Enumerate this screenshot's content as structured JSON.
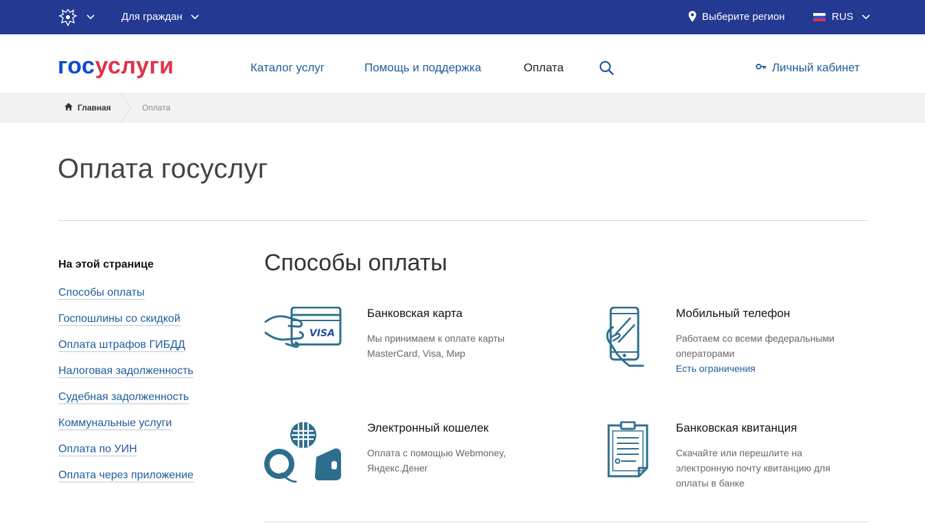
{
  "topbar": {
    "audience_label": "Для граждан",
    "region_label": "Выберите регион",
    "language_label": "RUS"
  },
  "header": {
    "logo_part1": "гос",
    "logo_part2": "услуги",
    "nav": {
      "catalog": "Каталог услуг",
      "help": "Помощь и поддержка",
      "payment": "Оплата"
    },
    "cabinet_label": "Личный кабинет"
  },
  "breadcrumb": {
    "home": "Главная",
    "current": "Оплата"
  },
  "page": {
    "title": "Оплата госуслуг"
  },
  "sidebar": {
    "heading": "На этой странице",
    "links": [
      "Способы оплаты",
      "Госпошлины со скидкой",
      "Оплата штрафов ГИБДД",
      "Налоговая задолженность",
      "Судебная задолженность",
      "Коммунальные услуги",
      "Оплата по УИН",
      "Оплата через приложение"
    ]
  },
  "methods_section": {
    "title": "Способы оплаты",
    "items": [
      {
        "title": "Банковская карта",
        "desc": "Мы принимаем к оплате карты MasterCard, Visa, Мир",
        "icon": "bank-card-icon",
        "card_brand": "VISA"
      },
      {
        "title": "Мобильный телефон",
        "desc": "Работаем со всеми федеральными операторами",
        "link": "Есть ограничения",
        "icon": "mobile-phone-icon"
      },
      {
        "title": "Электронный кошелек",
        "desc": "Оплата с помощью Webmoney, Яндекс.Денег",
        "icon": "e-wallet-icon"
      },
      {
        "title": "Банковская квитанция",
        "desc": "Скачайте или перешлите на электронную почту квитанцию для оплаты в банке",
        "icon": "bank-receipt-icon"
      }
    ]
  },
  "colors": {
    "topbar_bg": "#233992",
    "logo_blue": "#0d4cd3",
    "logo_red": "#e3314b",
    "link_blue": "#1f5b9b",
    "icon_teal": "#2d6e8e"
  }
}
